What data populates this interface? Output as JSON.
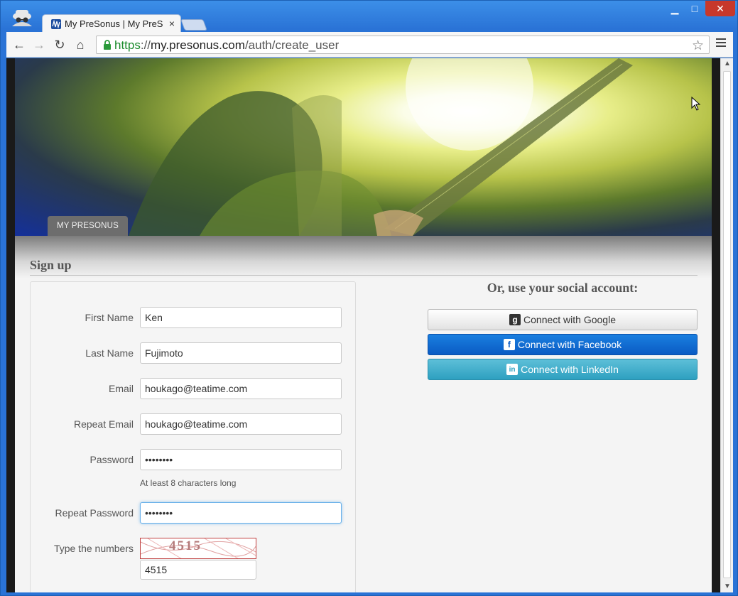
{
  "browser": {
    "tab_title": "My PreSonus | My PreS",
    "tab_close": "×",
    "url_scheme": "https",
    "url_sep": "://",
    "url_host": "my.presonus.com",
    "url_path": "/auth/create_user",
    "min_glyph": "▁",
    "max_glyph": "□",
    "close_glyph": "✕",
    "back_glyph": "←",
    "forward_glyph": "→",
    "reload_glyph": "↻",
    "home_glyph": "⌂",
    "star_glyph": "☆"
  },
  "hero": {
    "tab_label": "MY PRESONUS"
  },
  "signup": {
    "title": "Sign up",
    "fields": [
      {
        "label": "First Name",
        "value": "Ken"
      },
      {
        "label": "Last Name",
        "value": "Fujimoto"
      },
      {
        "label": "Email",
        "value": "houkago@teatime.com"
      },
      {
        "label": "Repeat Email",
        "value": "houkago@teatime.com"
      },
      {
        "label": "Password",
        "value": "••••••••"
      },
      {
        "label": "Repeat Password",
        "value": "••••••••"
      }
    ],
    "password_hint": "At least 8 characters long",
    "captcha_label": "Type the numbers",
    "captcha_image_text": "4515",
    "captcha_value": "4515"
  },
  "social": {
    "title": "Or, use your social account:",
    "google_label": "Connect with Google",
    "facebook_label": "Connect with Facebook",
    "linkedin_label": "Connect with LinkedIn",
    "google_icon_glyph": "g",
    "facebook_icon_glyph": "f",
    "linkedin_icon_glyph": "in"
  },
  "scrollbar": {
    "up_glyph": "▲",
    "down_glyph": "▼"
  },
  "colors": {
    "facebook": "#0a5bc4",
    "linkedin": "#2ea0c0",
    "window_frame": "#2a73d6",
    "secure_green": "#1a8b2b"
  }
}
